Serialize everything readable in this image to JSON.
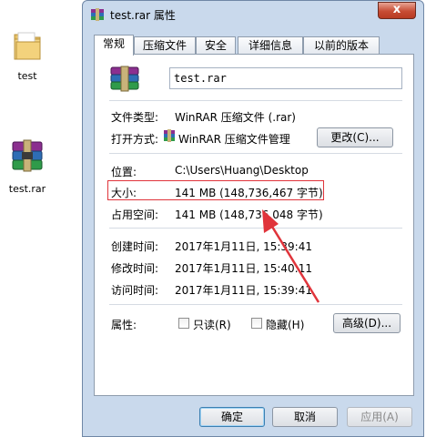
{
  "desktop": {
    "folder_label": "test",
    "rar_label": "test.rar"
  },
  "window": {
    "title": "test.rar 属性",
    "close_glyph": "x",
    "tabs": [
      "常规",
      "压缩文件",
      "安全",
      "详细信息",
      "以前的版本"
    ]
  },
  "general": {
    "filename": "test.rar",
    "file_type_label": "文件类型:",
    "file_type_value": "WinRAR 压缩文件 (.rar)",
    "opens_with_label": "打开方式:",
    "opens_with_value": "WinRAR 压缩文件管理",
    "change_button": "更改(C)...",
    "location_label": "位置:",
    "location_value": "C:\\Users\\Huang\\Desktop",
    "size_label": "大小:",
    "size_value": "141 MB (148,736,467 字节)",
    "size_on_disk_label": "占用空间:",
    "size_on_disk_value": "141 MB (148,736,048 字节)",
    "created_label": "创建时间:",
    "created_value": "2017年1月11日, 15:39:41",
    "modified_label": "修改时间:",
    "modified_value": "2017年1月11日, 15:40:11",
    "accessed_label": "访问时间:",
    "accessed_value": "2017年1月11日, 15:39:41",
    "attributes_label": "属性:",
    "readonly_label": "只读(R)",
    "hidden_label": "隐藏(H)",
    "advanced_button": "高级(D)..."
  },
  "footer": {
    "ok": "确定",
    "cancel": "取消",
    "apply": "应用(A)"
  },
  "colors": {
    "highlight": "#e0343b",
    "arrow": "#e0343b"
  }
}
